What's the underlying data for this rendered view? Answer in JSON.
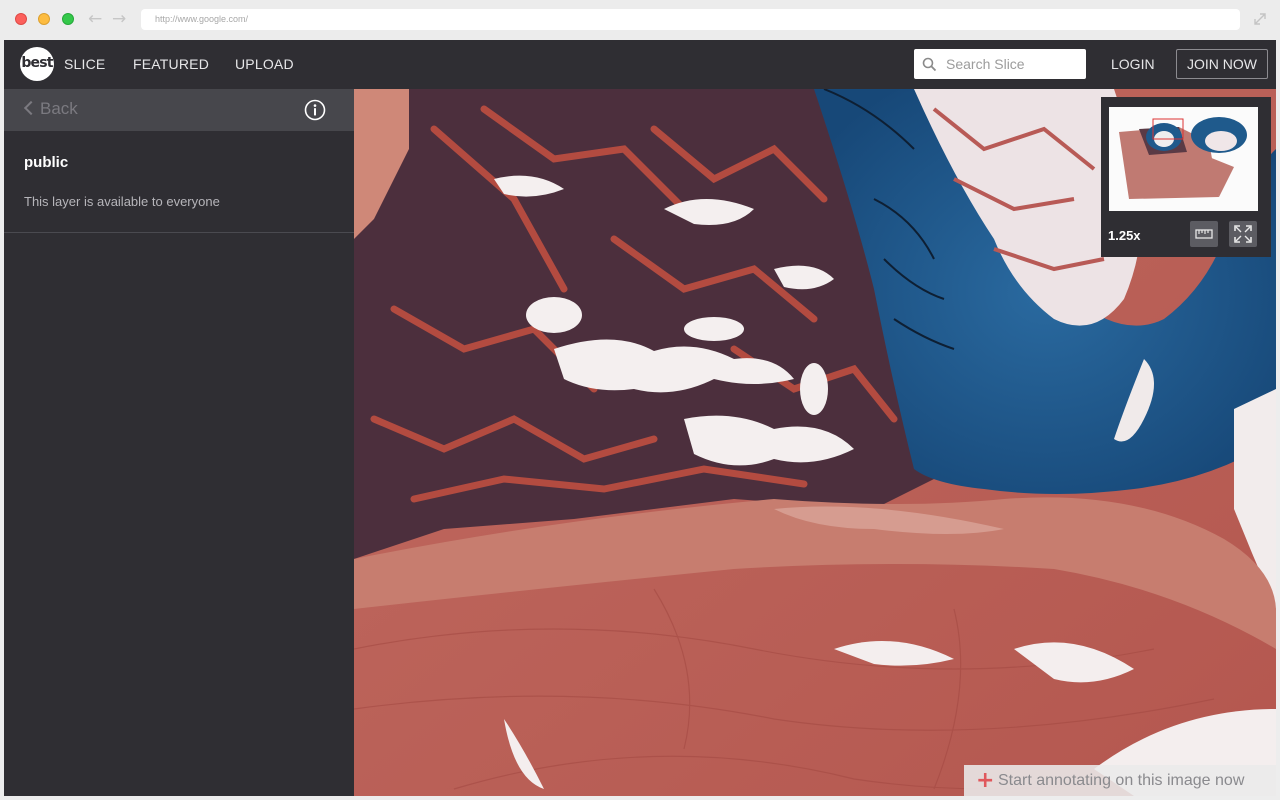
{
  "browser": {
    "url": "http://www.google.com/"
  },
  "header": {
    "logo_text": "best",
    "nav": [
      {
        "label": "SLICE"
      },
      {
        "label": "FEATURED"
      },
      {
        "label": "UPLOAD"
      }
    ],
    "search": {
      "placeholder": "Search Slice",
      "value": ""
    },
    "login_label": "LOGIN",
    "join_label": "JOIN NOW"
  },
  "sidebar": {
    "back_label": "Back",
    "layer": {
      "name": "public",
      "description": "This layer is available to everyone"
    }
  },
  "viewer": {
    "zoom": "1.25x",
    "annotate_label": "Start annotating on this image now"
  },
  "colors": {
    "app_bg": "#2f2e33",
    "sidebar_header": "#47474c",
    "annotate_plus": "#e0585c",
    "tissue_pink": "#b95a52",
    "cartilage_blue": "#1f5a8c",
    "marrow_dark": "#4a2e3a"
  },
  "icons": {
    "back": "chevron-left-icon",
    "info": "info-icon",
    "search": "search-icon",
    "ruler": "ruler-icon",
    "fullscreen": "fullscreen-icon",
    "annotate": "plus-icon",
    "expand": "expand-icon"
  }
}
